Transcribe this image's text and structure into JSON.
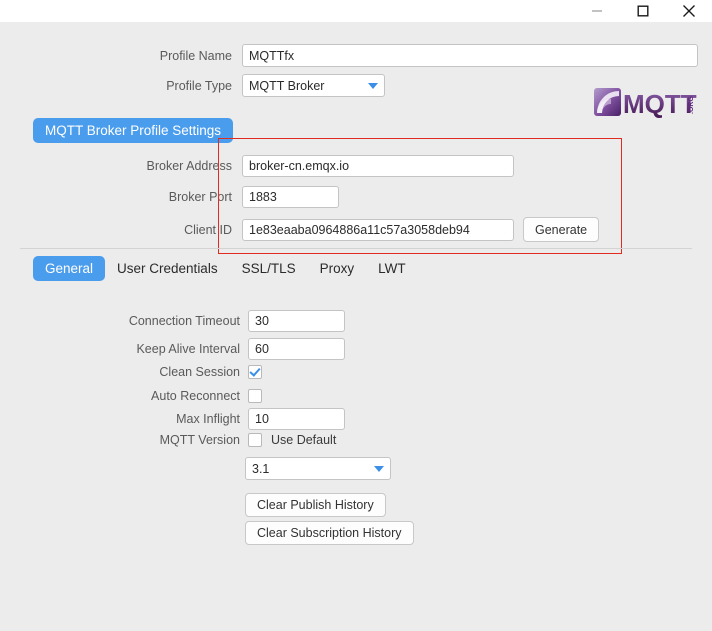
{
  "window": {
    "controls": [
      {
        "name": "minimize",
        "glyph": "—"
      },
      {
        "name": "maximize",
        "glyph": "☐"
      },
      {
        "name": "close",
        "glyph": "✕"
      }
    ]
  },
  "header": {
    "profile_name_label": "Profile Name",
    "profile_name_value": "MQTTfx",
    "profile_type_label": "Profile Type",
    "profile_type_value": "MQTT Broker",
    "logo_text": "MQTT",
    "logo_suffix": ".ORG"
  },
  "section": {
    "badge_label": "MQTT Broker Profile Settings",
    "broker_address_label": "Broker Address",
    "broker_address_value": "broker-cn.emqx.io",
    "broker_port_label": "Broker Port",
    "broker_port_value": "1883",
    "client_id_label": "Client ID",
    "client_id_value": "1e83eaaba0964886a11c57a3058deb94",
    "generate_label": "Generate"
  },
  "tabs": [
    {
      "label": "General",
      "active": true
    },
    {
      "label": "User Credentials",
      "active": false
    },
    {
      "label": "SSL/TLS",
      "active": false
    },
    {
      "label": "Proxy",
      "active": false
    },
    {
      "label": "LWT",
      "active": false
    }
  ],
  "general": {
    "connection_timeout_label": "Connection Timeout",
    "connection_timeout_value": "30",
    "keep_alive_label": "Keep Alive Interval",
    "keep_alive_value": "60",
    "clean_session_label": "Clean Session",
    "clean_session_checked": true,
    "auto_reconnect_label": "Auto Reconnect",
    "auto_reconnect_checked": false,
    "max_inflight_label": "Max Inflight",
    "max_inflight_value": "10",
    "mqtt_version_label": "MQTT Version",
    "use_default_label": "Use Default",
    "use_default_checked": false,
    "mqtt_version_value": "3.1",
    "clear_publish_label": "Clear Publish History",
    "clear_subscription_label": "Clear Subscription History"
  },
  "colors": {
    "accent_blue": "#4a9ced",
    "annotation_red": "#e02b20",
    "background": "#ececec",
    "logo_purple": "#5f2a7e"
  }
}
